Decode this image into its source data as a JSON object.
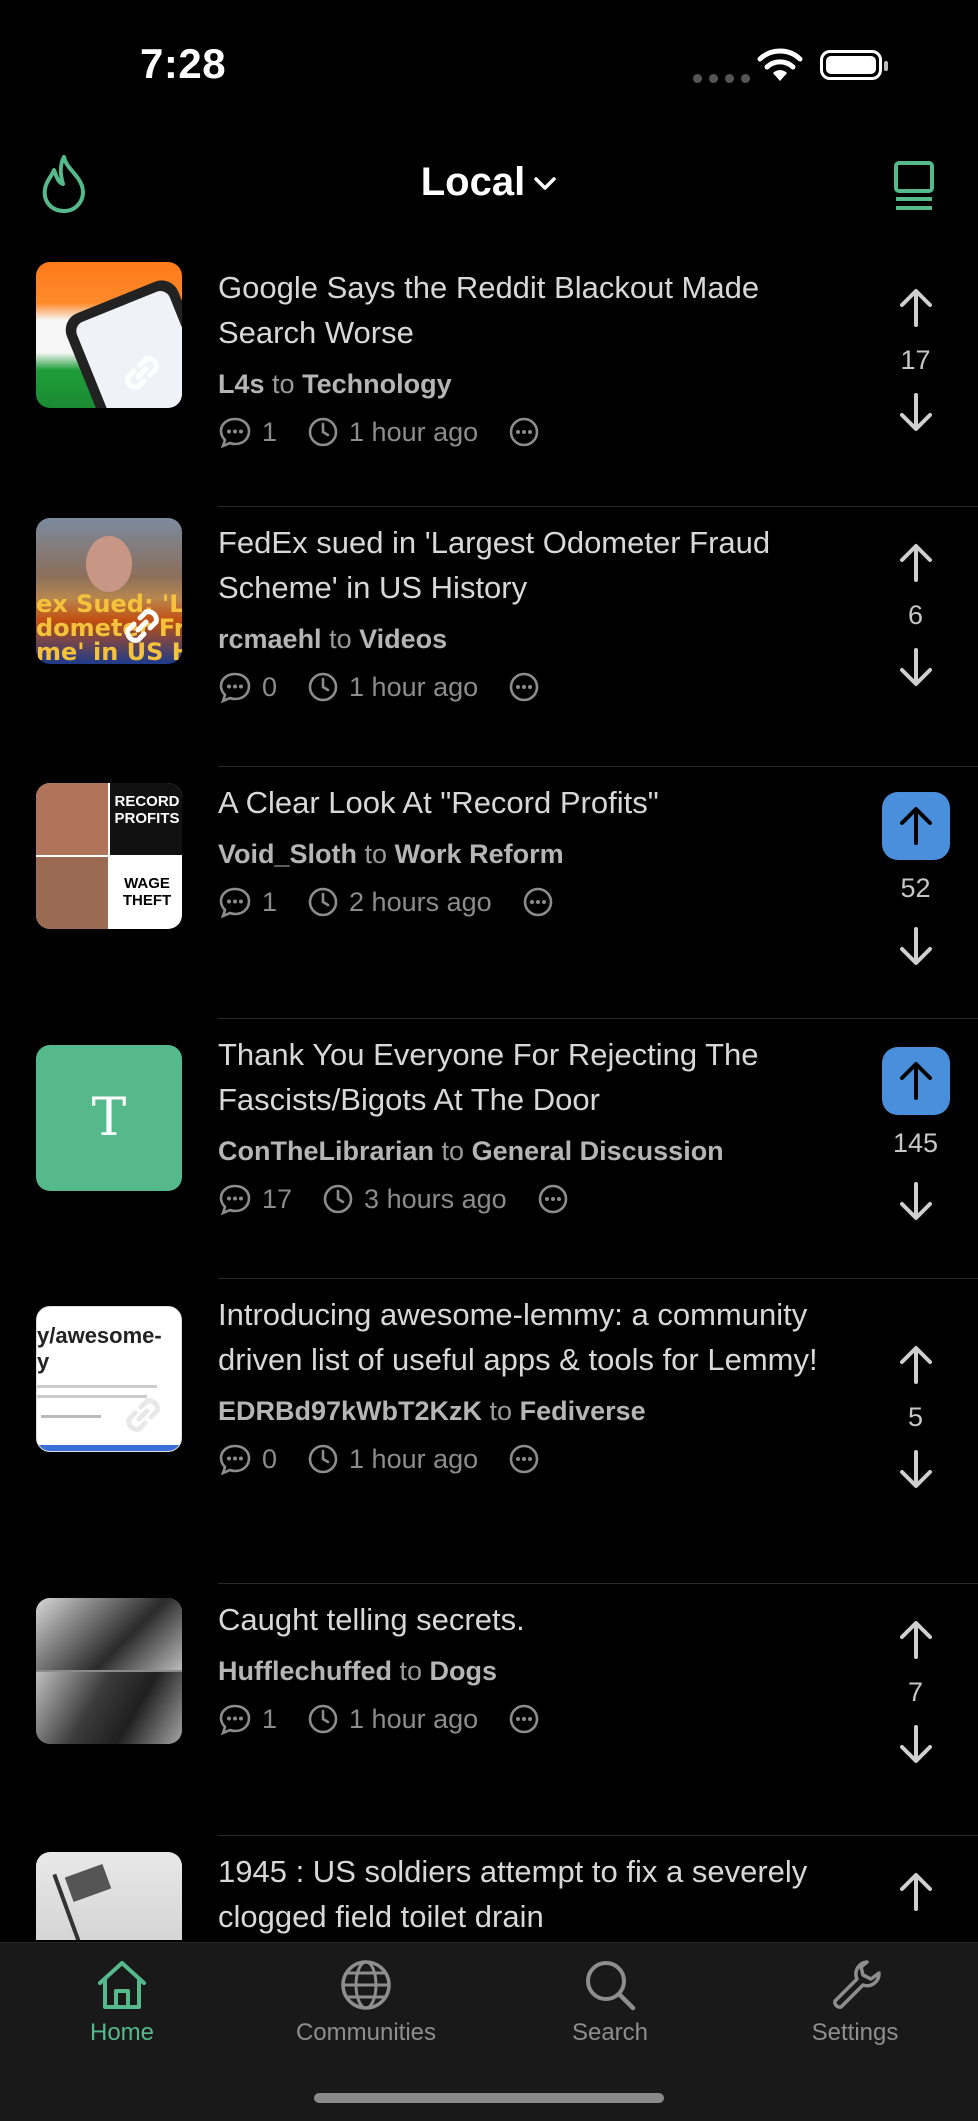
{
  "status": {
    "time": "7:28"
  },
  "header": {
    "feed": "Local"
  },
  "posts": [
    {
      "title": "Google Says the Reddit Blackout Made Search Worse",
      "author": "L4s",
      "to": "to",
      "community": "Technology",
      "comments": "1",
      "time": "1 hour ago",
      "score": "17",
      "upvoted": false
    },
    {
      "title": "FedEx sued in 'Largest Odometer Fraud Scheme' in US History",
      "author": "rcmaehl",
      "to": "to",
      "community": "Videos",
      "comments": "0",
      "time": "1 hour ago",
      "score": "6",
      "upvoted": false
    },
    {
      "title": "A Clear Look At \"Record Profits\"",
      "author": "Void_Sloth",
      "to": "to",
      "community": "Work Reform",
      "comments": "1",
      "time": "2 hours ago",
      "score": "52",
      "upvoted": true,
      "thumb_text": [
        "RECORD PROFITS",
        "WAGE THEFT"
      ]
    },
    {
      "title": "Thank You Everyone For Rejecting The Fascists/Bigots At The Door",
      "author": "ConTheLibrarian",
      "to": "to",
      "community": "General Discussion",
      "comments": "17",
      "time": "3 hours ago",
      "score": "145",
      "upvoted": true,
      "thumb_letter": "T"
    },
    {
      "title": "Introducing awesome-lemmy: a community driven list of useful apps & tools for Lemmy!",
      "author": "EDRBd97kWbT2KzK",
      "to": "to",
      "community": "Fediverse",
      "comments": "0",
      "time": "1 hour ago",
      "score": "5",
      "upvoted": false,
      "thumb_text": [
        "y/awesome-",
        "y"
      ]
    },
    {
      "title": "Caught telling secrets.",
      "author": "Hufflechuffed",
      "to": "to",
      "community": "Dogs",
      "comments": "1",
      "time": "1 hour ago",
      "score": "7",
      "upvoted": false
    },
    {
      "title": "1945 : US soldiers attempt to fix a severely clogged field toilet drain",
      "score": "",
      "upvoted": false
    }
  ],
  "tabs": [
    {
      "label": "Home",
      "icon": "house-icon",
      "active": true
    },
    {
      "label": "Communities",
      "icon": "globe-icon"
    },
    {
      "label": "Search",
      "icon": "magnifier-icon"
    },
    {
      "label": "Settings",
      "icon": "wrench-icon"
    }
  ],
  "colors": {
    "accent": "#55b98c",
    "upvote": "#4a8fdc",
    "background": "#000000"
  }
}
